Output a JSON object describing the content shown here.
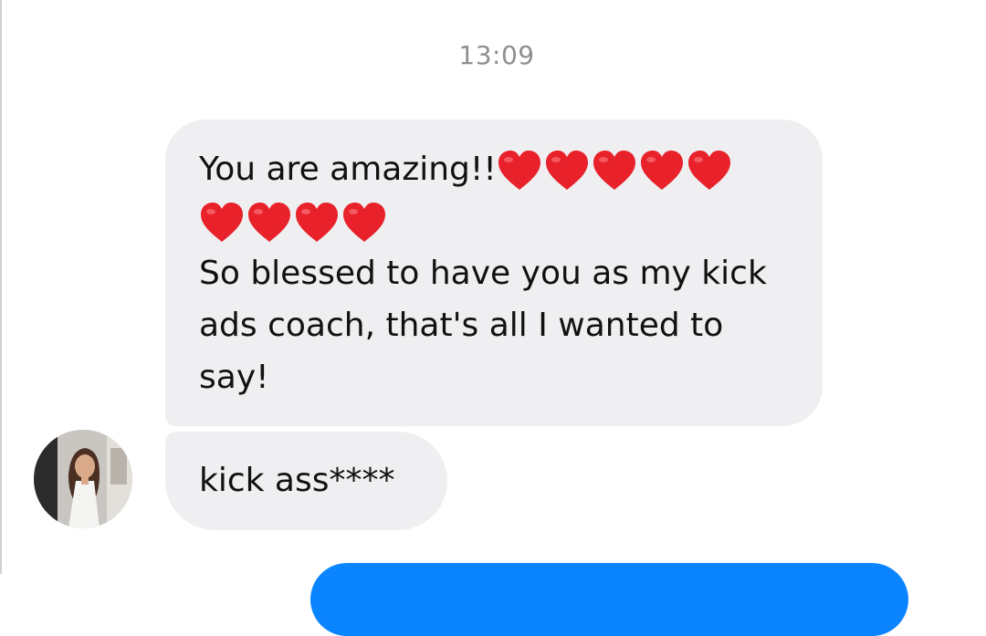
{
  "conversation": {
    "timestamp": "13:09",
    "messages": [
      {
        "line1_text": "You are amazing!!",
        "line1_heart_count": 5,
        "line2_heart_count": 4,
        "body_text": "So blessed to have you as my kick ads coach, that's all I wanted to say!"
      },
      {
        "text": "kick ass****"
      }
    ]
  },
  "colors": {
    "incoming_bubble": "#efeff1",
    "outgoing_bubble": "#0b84ff",
    "heart": "#e8212a",
    "timestamp_text": "#8e8e93"
  },
  "icons": {
    "heart": "red-heart-emoji"
  }
}
